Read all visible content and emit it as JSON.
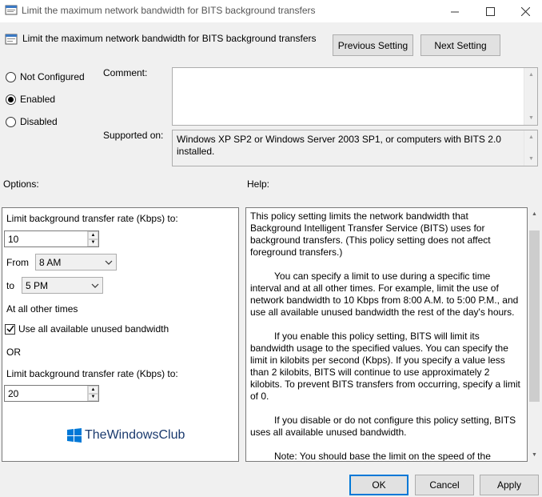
{
  "window": {
    "title": "Limit the maximum network bandwidth for BITS background transfers"
  },
  "header": {
    "policy_title": "Limit the maximum network bandwidth for BITS background transfers",
    "previous_label": "Previous Setting",
    "next_label": "Next Setting"
  },
  "state": {
    "options": [
      {
        "label": "Not Configured",
        "selected": false
      },
      {
        "label": "Enabled",
        "selected": true
      },
      {
        "label": "Disabled",
        "selected": false
      }
    ]
  },
  "comment": {
    "label": "Comment:",
    "value": ""
  },
  "supported": {
    "label": "Supported on:",
    "value": "Windows XP SP2 or Windows Server 2003 SP1, or computers with BITS 2.0 installed."
  },
  "options_panel": {
    "heading": "Options:",
    "rate_label": "Limit background transfer rate (Kbps) to:",
    "rate_value": "10",
    "from_label": "From",
    "from_value": "8 AM",
    "to_label": "to",
    "to_value": "5 PM",
    "other_times_label": "At all other times",
    "use_all_label": "Use all available unused bandwidth",
    "use_all_checked": true,
    "or_label": "OR",
    "rate2_label": "Limit background transfer rate (Kbps) to:",
    "rate2_value": "20",
    "watermark": "TheWindowsClub"
  },
  "help_panel": {
    "heading": "Help:",
    "paragraphs": [
      "This policy setting limits the network bandwidth that Background Intelligent Transfer Service (BITS) uses for background transfers. (This policy setting does not affect foreground transfers.)",
      "You can specify a limit to use during a specific time interval and at all other times. For example, limit the use of network bandwidth to 10 Kbps from 8:00 A.M. to 5:00 P.M., and use all available unused bandwidth the rest of the day's hours.",
      "If you enable this policy setting, BITS will limit its bandwidth usage to the specified values. You can specify the limit in kilobits per second (Kbps). If you specify a value less than 2 kilobits, BITS will continue to use approximately 2 kilobits. To prevent BITS transfers from occurring, specify a limit of 0.",
      "If you disable or do not configure this policy setting, BITS uses all available unused bandwidth.",
      "Note: You should base the limit on the speed of the network link, not the computer's network interface card (NIC)."
    ]
  },
  "footer": {
    "ok_label": "OK",
    "cancel_label": "Cancel",
    "apply_label": "Apply"
  },
  "colors": {
    "accent": "#0078d7",
    "background": "#f0f0f0"
  }
}
